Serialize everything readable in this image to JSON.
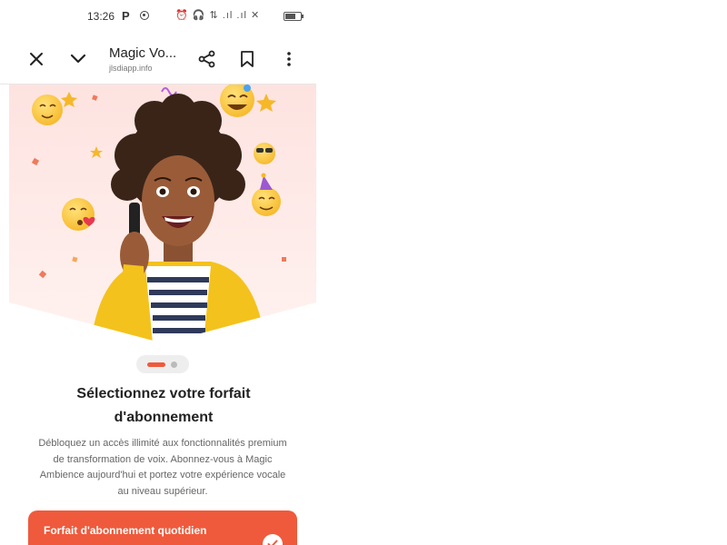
{
  "status_bar": {
    "time": "13:26",
    "indicator": "P",
    "icons_text": "⏰ 🎧 ⇅ .ıl .ıl ✕",
    "icons": [
      "record-icon",
      "alarm-icon",
      "headset-icon",
      "data-icon",
      "signal-icon",
      "signal-icon",
      "wifi-off-icon",
      "battery-icon"
    ]
  },
  "toolbar": {
    "title": "Magic Vo...",
    "url": "jlsdiapp.info",
    "icons": [
      "close-icon",
      "chevron-down-icon",
      "share-icon",
      "bookmark-icon",
      "more-vert-icon"
    ]
  },
  "hero": {
    "image": "smiling-woman-on-phone-with-emojis"
  },
  "pager": {
    "pages": 2,
    "active": 1
  },
  "main": {
    "heading_line1": "Sélectionnez votre forfait",
    "heading_line2": "d'abonnement",
    "desc_line1": "Débloquez un accès illimité aux fonctionnalités premium",
    "desc_line2": "de transformation de voix. Abonnez-vous à Magic",
    "desc_line3": "Ambience aujourd'hui et portez votre expérience vocale",
    "desc_line4": "au niveau supérieur."
  },
  "plan": {
    "title": "Forfait d'abonnement quotidien",
    "selected": true
  },
  "colors": {
    "accent": "#ef5a3c",
    "hero_bg_top": "#fde3e0",
    "jacket": "#f4c21c"
  }
}
